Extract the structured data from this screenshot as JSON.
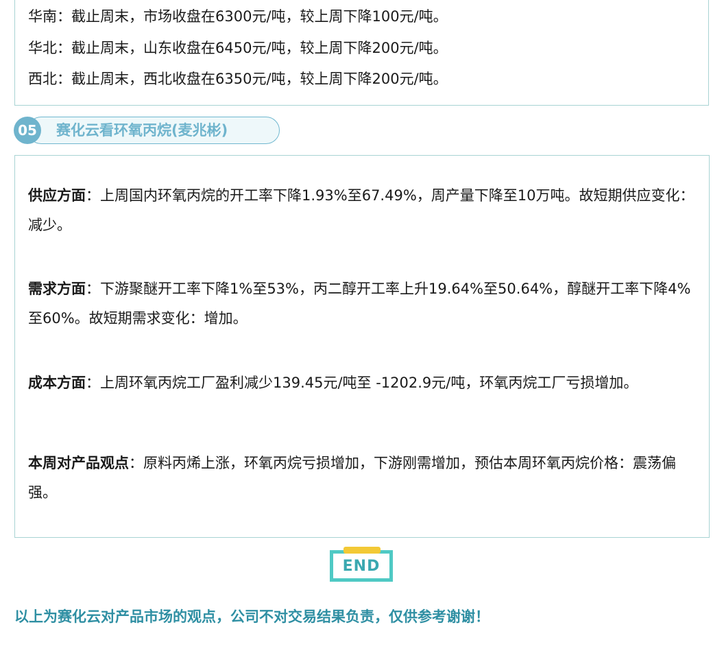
{
  "regions": [
    "华南：截止周末，市场收盘在6300元/吨，较上周下降100元/吨。",
    "华北：截止周末，山东收盘在6450元/吨，较上周下降200元/吨。",
    "西北：截止周末，西北收盘在6350元/吨，较上周下降200元/吨。"
  ],
  "section": {
    "number": "05",
    "title": "赛化云看环氧丙烷(麦兆彬)"
  },
  "paragraphs": [
    {
      "label": "供应方面",
      "text": "：上周国内环氧丙烷的开工率下降1.93%至67.49%，周产量下降至10万吨。故短期供应变化：减少。"
    },
    {
      "label": "需求方面",
      "text": "：下游聚醚开工率下降1%至53%，丙二醇开工率上升19.64%至50.64%，醇醚开工率下降4%至60%。故短期需求变化：增加。"
    },
    {
      "label": "成本方面",
      "text": "：上周环氧丙烷工厂盈利减少139.45元/吨至 -1202.9元/吨，环氧丙烷工厂亏损增加。"
    },
    {
      "label": "本周对产品观点",
      "text": "：原料丙烯上涨，环氧丙烷亏损增加，下游刚需增加，预估本周环氧丙烷价格：震荡偏强。"
    }
  ],
  "end_label": "END",
  "footer": "以上为赛化云对产品市场的观点，公司不对交易结果负责，仅供参考谢谢！",
  "colors": {
    "accent": "#6fb4cd",
    "border": "#a8d3d3",
    "end_frame": "#4fc9c4",
    "end_clip": "#f3c936",
    "footer_text": "#2f8fa3"
  }
}
